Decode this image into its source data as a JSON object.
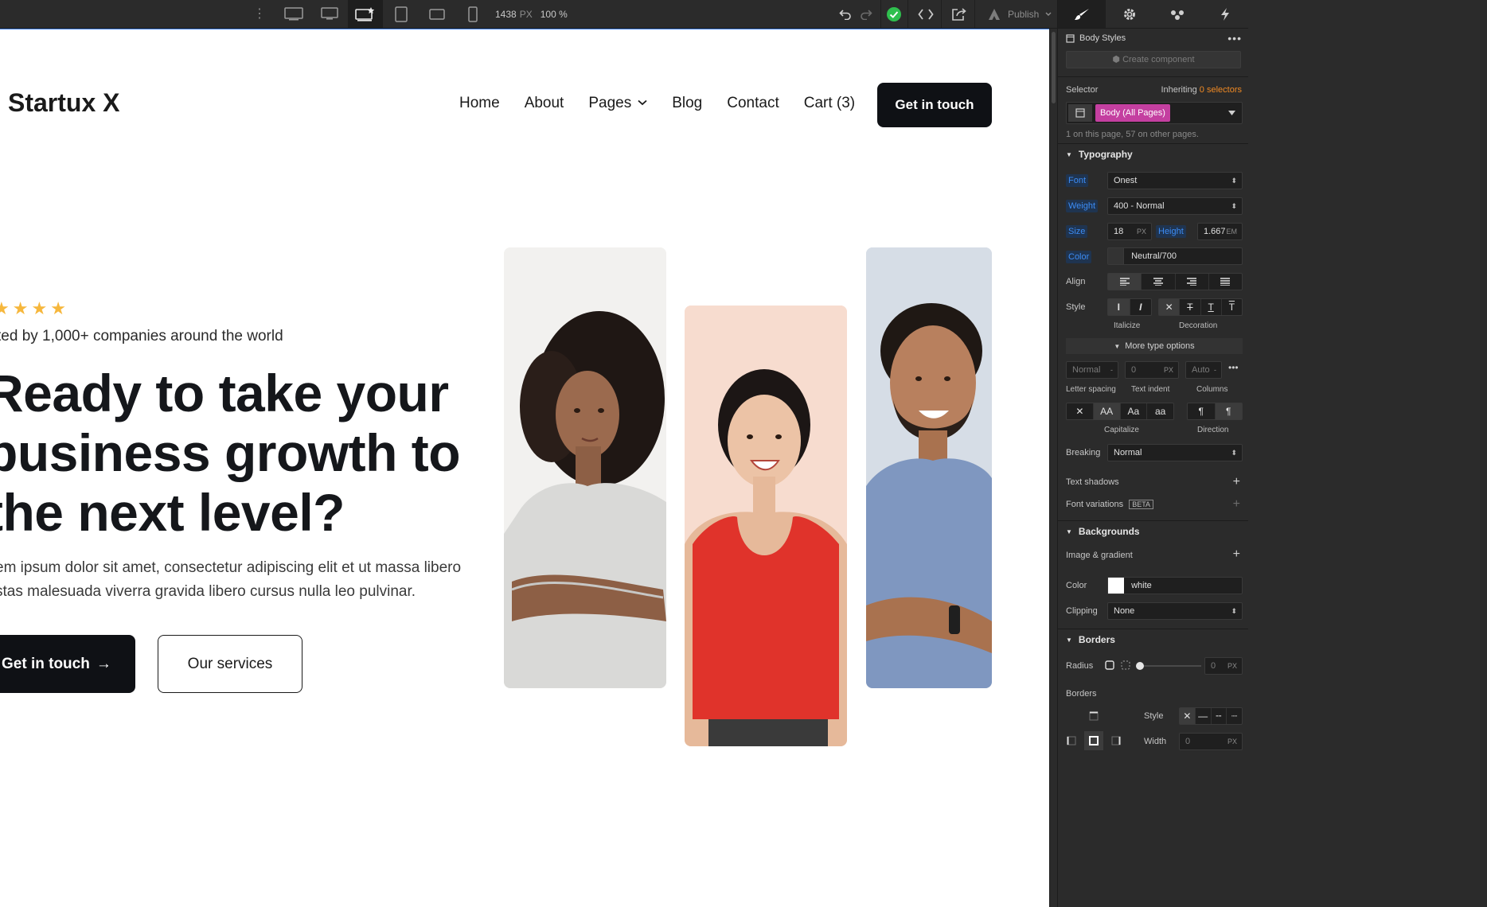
{
  "toolbar": {
    "canvas_width": "1438",
    "canvas_unit": "PX",
    "zoom": "100 %",
    "publish_label": "Publish",
    "status_color": "#2fbf4e"
  },
  "site": {
    "logo": "Startux X",
    "nav": [
      "Home",
      "About",
      "Pages",
      "Blog",
      "Contact",
      "Cart (3)"
    ],
    "nav_cta": "Get in touch",
    "stars": [
      "★",
      "★",
      "★",
      "★"
    ],
    "trusted": "ted by 1,000+ companies around the world",
    "headline": [
      "Ready to take your",
      "business growth to",
      "the next level?"
    ],
    "lede": [
      "em ipsum dolor sit amet, consectetur adipiscing elit et ut massa libero",
      "stas malesuada viverra gravida libero cursus nulla leo pulvinar."
    ],
    "cta_primary": "Get in touch",
    "cta_primary_arrow": "→",
    "cta_secondary": "Our services"
  },
  "panel": {
    "header_title": "Body Styles",
    "create_component": "Create component",
    "selector_label": "Selector",
    "inheriting": "Inheriting",
    "inheriting_count": "0 selectors",
    "selector_chip": "Body (All Pages)",
    "selector_note": "1 on this page, 57 on other pages.",
    "typography": {
      "title": "Typography",
      "font_label": "Font",
      "font_value": "Onest",
      "weight_label": "Weight",
      "weight_value": "400 - Normal",
      "size_label": "Size",
      "size_value": "18",
      "size_unit": "PX",
      "height_label": "Height",
      "height_value": "1.667",
      "height_unit": "EM",
      "color_label": "Color",
      "color_value": "Neutral/700",
      "align_label": "Align",
      "style_label": "Style",
      "italicize_caption": "Italicize",
      "decoration_caption": "Decoration",
      "more_options": "More type options",
      "letter_spacing_value": "Normal",
      "letter_spacing_caption": "Letter spacing",
      "text_indent_value": "0",
      "text_indent_unit": "PX",
      "text_indent_caption": "Text indent",
      "columns_value": "Auto",
      "columns_caption": "Columns",
      "capitalize_caption": "Capitalize",
      "direction_caption": "Direction",
      "cap_options": [
        "✕",
        "AA",
        "Aa",
        "aa"
      ],
      "breaking_label": "Breaking",
      "breaking_value": "Normal",
      "text_shadows": "Text shadows",
      "font_variations": "Font variations",
      "beta": "BETA"
    },
    "backgrounds": {
      "title": "Backgrounds",
      "image_gradient": "Image & gradient",
      "color_label": "Color",
      "color_value": "white",
      "clipping_label": "Clipping",
      "clipping_value": "None"
    },
    "borders": {
      "title": "Borders",
      "radius_label": "Radius",
      "radius_value": "0",
      "radius_unit": "PX",
      "borders_label": "Borders",
      "style_label": "Style",
      "width_label": "Width",
      "width_value": "0",
      "width_unit": "PX"
    },
    "accent_color": "#3c8cf5",
    "selector_chip_color": "#c43fa0",
    "inherit_color": "#f08a24"
  }
}
